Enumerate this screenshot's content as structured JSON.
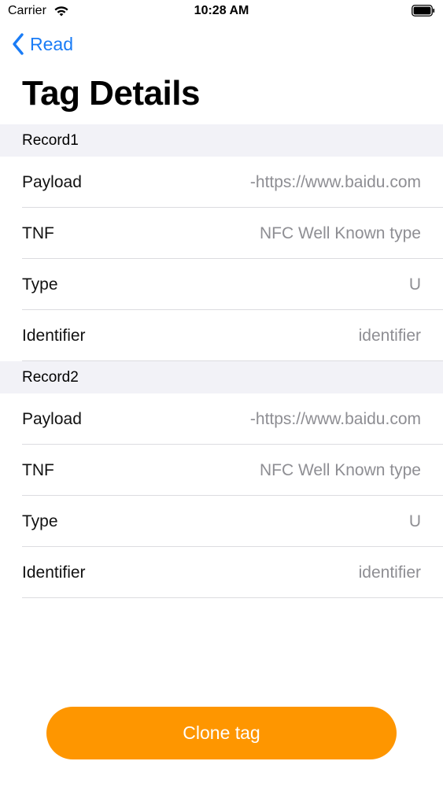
{
  "status_bar": {
    "carrier": "Carrier",
    "time": "10:28 AM",
    "icons": [
      "wifi-icon",
      "battery-icon"
    ]
  },
  "nav": {
    "back_label": "Read",
    "back_icon": "chevron-left-icon",
    "title": "Tag Details"
  },
  "records": [
    {
      "header": "Record1",
      "rows": [
        {
          "label": "Payload",
          "value": "-https://www.baidu.com"
        },
        {
          "label": "TNF",
          "value": "NFC Well Known type"
        },
        {
          "label": "Type",
          "value": "U"
        },
        {
          "label": "Identifier",
          "value": "identifier"
        }
      ]
    },
    {
      "header": "Record2",
      "rows": [
        {
          "label": "Payload",
          "value": "-https://www.baidu.com"
        },
        {
          "label": "TNF",
          "value": "NFC Well Known type"
        },
        {
          "label": "Type",
          "value": "U"
        },
        {
          "label": "Identifier",
          "value": "identifier"
        }
      ]
    }
  ],
  "actions": {
    "clone_label": "Clone tag"
  },
  "colors": {
    "accent": "#1a7cf6",
    "button": "#fe9600",
    "section_bg": "#f2f2f7",
    "secondary_text": "#8e8e93"
  }
}
